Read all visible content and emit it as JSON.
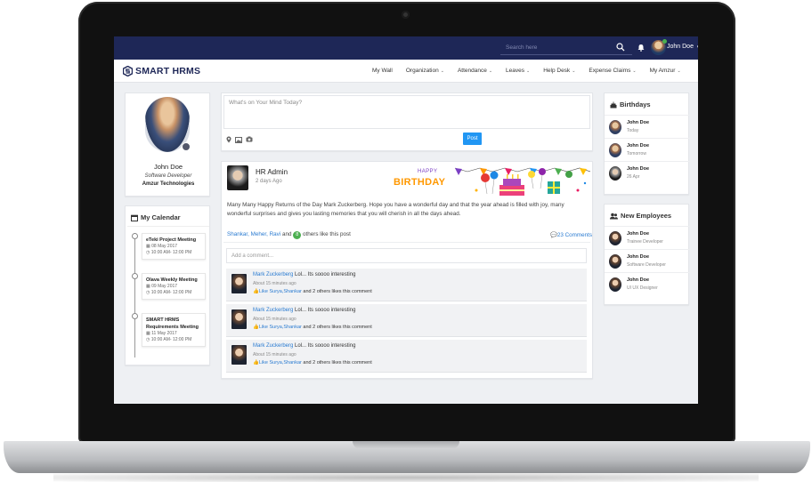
{
  "header": {
    "search_placeholder": "Search here",
    "user_name": "John Doe"
  },
  "nav": {
    "logo_text": "SMART HRMS",
    "items": [
      {
        "label": "My Wall",
        "dropdown": false
      },
      {
        "label": "Organization",
        "dropdown": true
      },
      {
        "label": "Attendance",
        "dropdown": true
      },
      {
        "label": "Leaves",
        "dropdown": true
      },
      {
        "label": "Help Desk",
        "dropdown": true
      },
      {
        "label": "Expense Claims",
        "dropdown": true
      },
      {
        "label": "My Amzur",
        "dropdown": true
      }
    ],
    "caret": "⌄"
  },
  "profile": {
    "name": "John Doe",
    "title": "Software Developer",
    "company": "Amzur Technologies"
  },
  "calendar": {
    "title": "My Calendar",
    "events": [
      {
        "name": "eTeki Project Meeting",
        "date": "08 May 2017",
        "time": "10:00 AM- 12:00 PM"
      },
      {
        "name": "Olava Weekly Meeting",
        "date": "09 May 2017",
        "time": "10:00 AM- 12:00 PM"
      },
      {
        "name": "SMART HRMS Requirements Meeting",
        "date": "11 May 2017",
        "time": "10:00 AM- 12:00 PM"
      }
    ]
  },
  "composer": {
    "placeholder": "What's on Your Mind Today?",
    "post_label": "Post"
  },
  "post": {
    "author": "HR Admin",
    "time": "2 days Ago",
    "banner_happy": "HAPPY",
    "banner_birthday": "BIRTHDAY",
    "text": "Many Many Happy Returns of the Day Mark Zuckerberg. Hope you have a wonderful day and that the year ahead is filled with joy, many wonderful surprises and gives you lasting memories that you will cherish in all the days ahead.",
    "likers": "Shankar, Meher, Ravi",
    "and": "and",
    "others_count": "8",
    "others_text": "others like this post",
    "comments_count": "23 Comments",
    "comment_placeholder": "Add a comment..."
  },
  "comments": [
    {
      "author": "Mark Zuckerberg",
      "text": "Lol... Its soooo interesting",
      "time": "About 15 minutes ago",
      "like": "Like",
      "likers": "Surya,Shankar",
      "suffix": "and 2 others likes this comment"
    },
    {
      "author": "Mark Zuckerberg",
      "text": "Lol... Its soooo interesting",
      "time": "About 15 minutes ago",
      "like": "Like",
      "likers": "Surya,Shankar",
      "suffix": "and 2 others likes this comment"
    },
    {
      "author": "Mark Zuckerberg",
      "text": "Lol... Its soooo interesting",
      "time": "About 15 minutes ago",
      "like": "Like",
      "likers": "Surya,Shankar",
      "suffix": "and 2 others likes this comment"
    }
  ],
  "birthdays": {
    "title": "Birthdays",
    "items": [
      {
        "name": "John Doe",
        "when": "Today"
      },
      {
        "name": "John Doe",
        "when": "Tomorrow"
      },
      {
        "name": "John Doe",
        "when": "26 Apr"
      }
    ]
  },
  "new_employees": {
    "title": "New Employees",
    "items": [
      {
        "name": "John Doe",
        "role": "Trainee Developer"
      },
      {
        "name": "John Doe",
        "role": "Software Developer"
      },
      {
        "name": "John Doe",
        "role": "UI UX Designer"
      }
    ]
  },
  "colors": {
    "topbar": "#1e2757",
    "accent": "#2196f3",
    "link": "#2a7bd1",
    "badge": "#4caf50"
  }
}
